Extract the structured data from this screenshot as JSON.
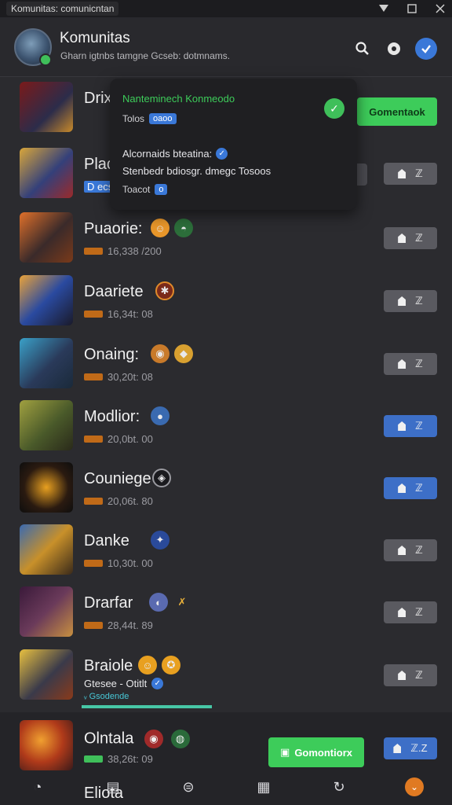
{
  "window": {
    "title": "Komunitas: comunicntan"
  },
  "header": {
    "title": "Komunitas",
    "subtitle": "Gharn igtnbs tamgne Gcseb: dotmnams."
  },
  "popup": {
    "title": "Nanteminech Konmeodo",
    "row1_text": "Tolos",
    "row1_pill": "oaoo",
    "line2": "Alcornaids bteatina:",
    "line3": "Stenbedr bdiosgr. dmegc Tosoos",
    "line4_text": "Toacot",
    "line4_pill": "o"
  },
  "side_button": {
    "label": "Gomentaok"
  },
  "rows": [
    {
      "name": "Drix",
      "meta": "",
      "button": ""
    },
    {
      "name": "Plac",
      "meta": "D ecs",
      "button": "ℤ"
    },
    {
      "name": "Puaorie:",
      "meta": "16,338 /200",
      "button": "ℤ"
    },
    {
      "name": "Daariete",
      "meta": "16,34t: 08",
      "button": "ℤ"
    },
    {
      "name": "Onaing:",
      "meta": "30,20t: 08",
      "button": "ℤ"
    },
    {
      "name": "Modlior:",
      "meta": "20,0bt. 00",
      "button": "ℤ"
    },
    {
      "name": "Couniege",
      "meta": "20,06t. 80",
      "button": "ℤ"
    },
    {
      "name": "Danke",
      "meta": "10,30t. 00",
      "button": "ℤ"
    },
    {
      "name": "Drarfar",
      "meta": "28,44t. 89",
      "button": "ℤ"
    },
    {
      "name": "Braiole",
      "meta": "Gtesee - Otitlt",
      "button": "ℤ"
    }
  ],
  "row_extra": {
    "sub_label": "ᵥ Gsodende"
  },
  "bottom": {
    "name": "Olntala",
    "meta": "38,26t: 09",
    "cta_label": "Gomontiorx",
    "button_label": "ℤ.Z",
    "ghost_name": "Eliota"
  },
  "colors": {
    "accent_green": "#3dcc5a",
    "accent_blue": "#3a78d8",
    "orange_tag": "#c06a18"
  }
}
